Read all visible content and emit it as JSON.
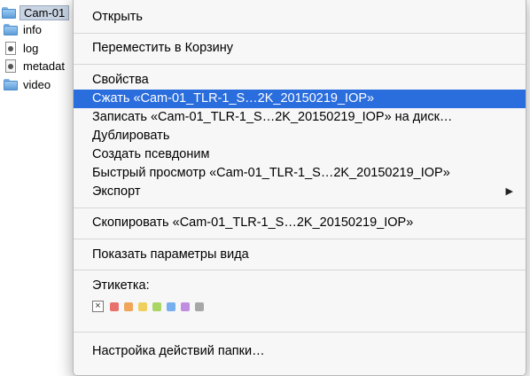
{
  "finder": {
    "items": [
      {
        "label": "Cam-01",
        "icon": "folder-icon",
        "selected": true
      },
      {
        "label": "info",
        "icon": "folder-icon"
      },
      {
        "label": "log",
        "icon": "file-icon"
      },
      {
        "label": "metadat",
        "icon": "metadata-file-icon"
      },
      {
        "label": "video",
        "icon": "folder-icon"
      }
    ]
  },
  "menu": {
    "open": "Открыть",
    "move_to_trash": "Переместить в Корзину",
    "properties": "Свойства",
    "compress": "Сжать «Cam-01_TLR-1_S…2K_20150219_IOP»",
    "burn": "Записать «Cam-01_TLR-1_S…2K_20150219_IOP» на диск…",
    "duplicate": "Дублировать",
    "make_alias": "Создать псевдоним",
    "quick_look": "Быстрый просмотр «Cam-01_TLR-1_S…2K_20150219_IOP»",
    "export": "Экспорт",
    "copy": "Скопировать «Cam-01_TLR-1_S…2K_20150219_IOP»",
    "show_view_options": "Показать параметры вида",
    "tags_label": "Этикетка:",
    "clear_tag": "×",
    "folder_actions": "Настройка действий папки…"
  },
  "tag_colors": [
    "#e8706d",
    "#f0a55a",
    "#efd05e",
    "#a9d665",
    "#76b0ee",
    "#c18de0",
    "#a7a7a7"
  ],
  "colors": {
    "highlight": "#2a6ddd"
  }
}
